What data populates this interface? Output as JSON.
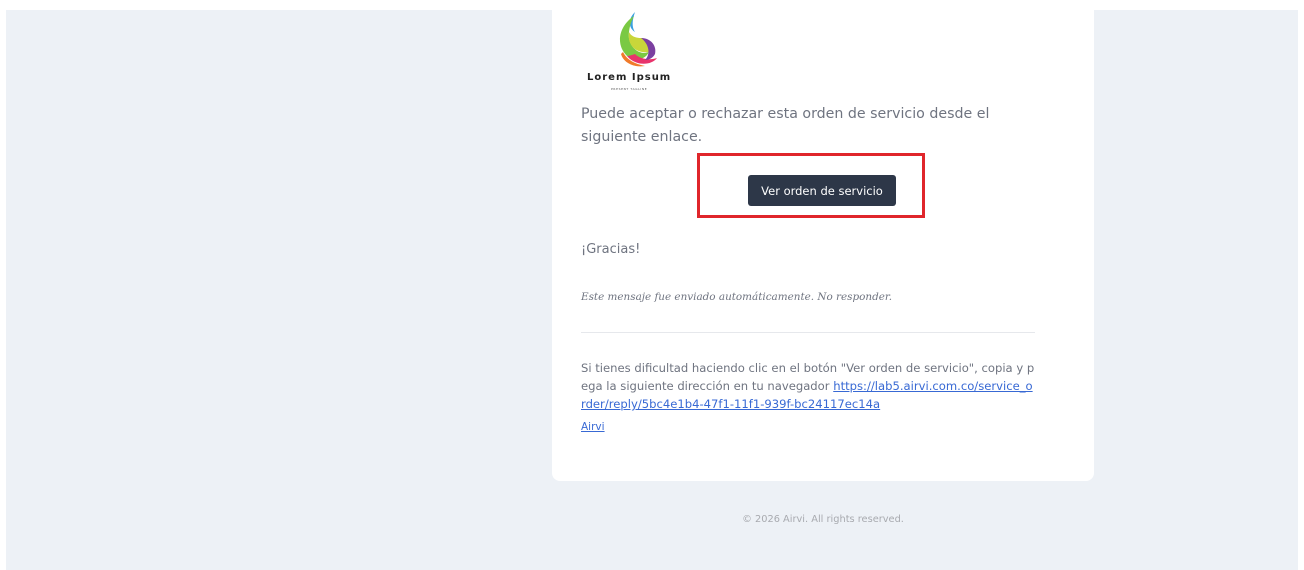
{
  "logo": {
    "name": "Lorem Ipsum",
    "tagline": "PRESENT TAGLINE"
  },
  "intro_text": "Puede aceptar o rechazar esta orden de servicio desde el siguiente enlace.",
  "cta_label": "Ver orden de servicio",
  "thanks": "¡Gracias!",
  "auto_note": "Este mensaje fue enviado automáticamente. No responder.",
  "help": {
    "text": "Si tienes dificultad haciendo clic en el botón \"Ver orden de servicio\", copia y pega la siguiente dirección en tu navegador ",
    "link": "https://lab5.airvi.com.co/service_order/reply/5bc4e1b4-47f1-11f1-939f-bc24117ec14a"
  },
  "brand_link": "Airvi",
  "footer": "© 2026 Airvi. All rights reserved.",
  "colors": {
    "button_bg": "#2d3748",
    "link": "#3869d4",
    "highlight_border": "#e0262b",
    "page_bg": "#edf1f6"
  }
}
